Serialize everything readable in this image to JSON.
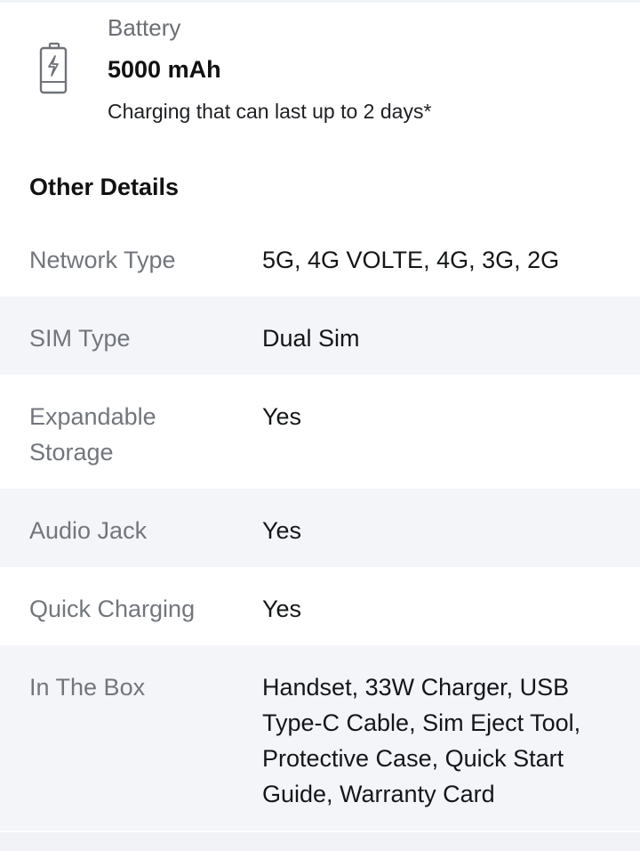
{
  "battery": {
    "icon": "battery-charging-icon",
    "label": "Battery",
    "value": "5000 mAh",
    "description": "Charging that can last up to 2 days*"
  },
  "other_details": {
    "title": "Other Details",
    "rows": [
      {
        "label": "Network Type",
        "value": "5G, 4G VOLTE, 4G, 3G, 2G"
      },
      {
        "label": "SIM Type",
        "value": "Dual Sim"
      },
      {
        "label": "Expandable Storage",
        "value": "Yes"
      },
      {
        "label": "Audio Jack",
        "value": "Yes"
      },
      {
        "label": "Quick Charging",
        "value": "Yes"
      },
      {
        "label": "In The Box",
        "value": "Handset, 33W Charger, USB Type-C Cable, Sim Eject Tool, Protective Case, Quick Start Guide, Warranty Card"
      }
    ]
  },
  "colors": {
    "page_background": "#f1f3f6",
    "alt_row_background": "#f4f5f9",
    "label_text": "#72767c",
    "value_text": "#141618"
  }
}
